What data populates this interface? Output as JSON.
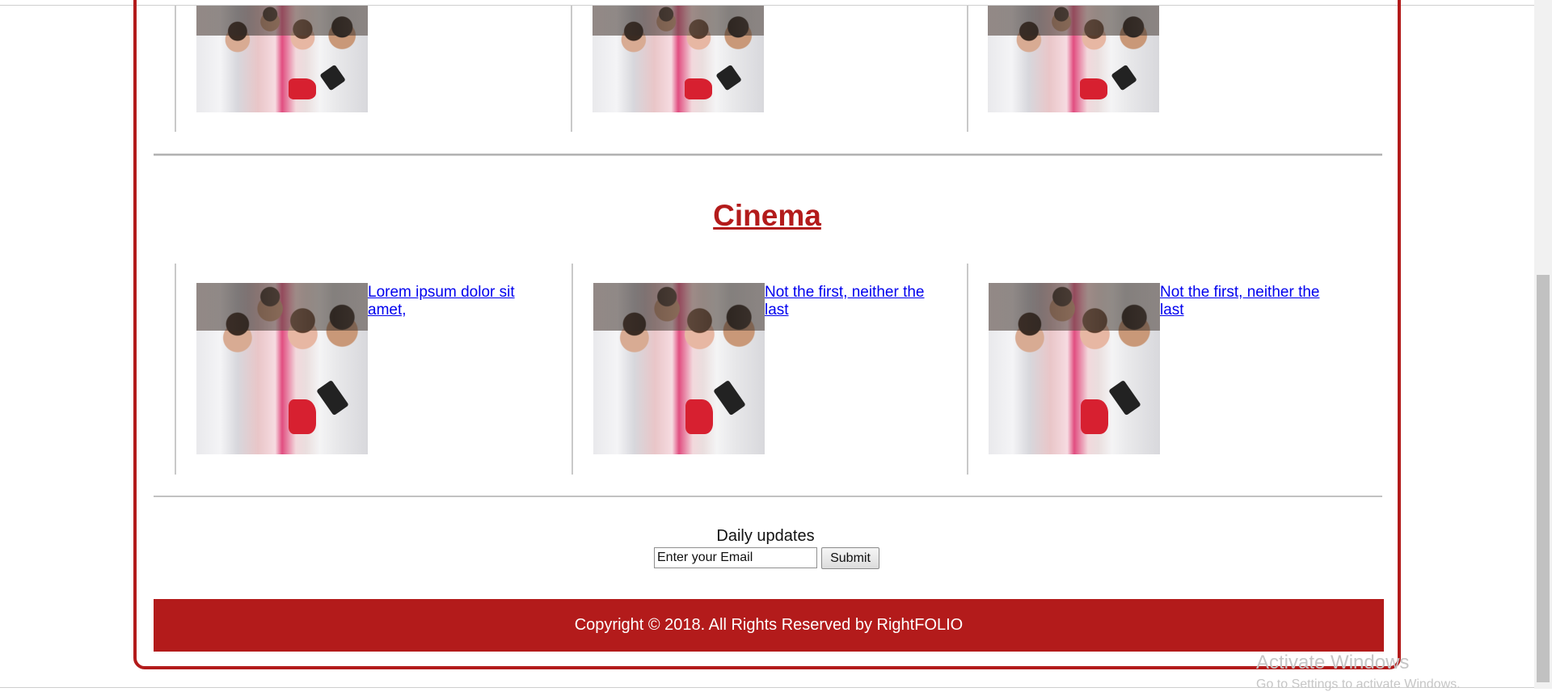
{
  "top_row": {
    "images": [
      "photo-group",
      "photo-group",
      "photo-group"
    ]
  },
  "cinema": {
    "heading": "Cinema",
    "articles": [
      {
        "title": "Lorem ipsum dolor sit amet,"
      },
      {
        "title": "Not the first, neither the last"
      },
      {
        "title": "Not the first, neither the last"
      }
    ]
  },
  "newsletter": {
    "label": "Daily updates",
    "email_placeholder": "Enter your Email",
    "submit_label": "Submit"
  },
  "footer": {
    "copyright": "Copyright © 2018. All Rights Reserved by RightFOLIO"
  },
  "os_overlay": {
    "activate_title": "Activate Windows",
    "activate_sub": "Go to Settings to activate Windows."
  },
  "colors": {
    "accent": "#b31b1b",
    "link": "#0000ee"
  }
}
